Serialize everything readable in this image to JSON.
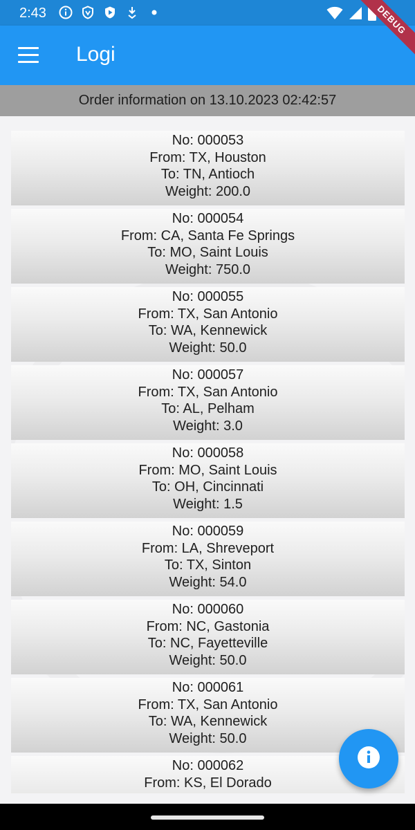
{
  "status_bar": {
    "time": "2:43",
    "icons": [
      "info-circle-icon",
      "shield-icon",
      "play-shield-icon",
      "download-icon",
      "dot-icon"
    ],
    "right_icons": [
      "wifi-icon",
      "signal-icon",
      "battery-icon"
    ]
  },
  "debug_banner": "DEBUG",
  "app_bar": {
    "title": "Logi",
    "menu_icon": "menu-icon",
    "color": "#2196f3"
  },
  "header": {
    "text": "Order information on 13.10.2023 02:42:57"
  },
  "orders": [
    {
      "no": "No: 000053",
      "from": "From: TX, Houston",
      "to": "To: TN, Antioch",
      "weight": "Weight: 200.0"
    },
    {
      "no": "No: 000054",
      "from": "From: CA, Santa Fe Springs",
      "to": "To: MO, Saint Louis",
      "weight": "Weight: 750.0"
    },
    {
      "no": "No: 000055",
      "from": "From: TX, San Antonio",
      "to": "To: WA, Kennewick",
      "weight": "Weight: 50.0"
    },
    {
      "no": "No: 000057",
      "from": "From: TX, San Antonio",
      "to": "To: AL, Pelham",
      "weight": "Weight: 3.0"
    },
    {
      "no": "No: 000058",
      "from": "From: MO, Saint Louis",
      "to": "To: OH, Cincinnati",
      "weight": "Weight: 1.5"
    },
    {
      "no": "No: 000059",
      "from": "From: LA, Shreveport",
      "to": "To: TX, Sinton",
      "weight": "Weight: 54.0"
    },
    {
      "no": "No: 000060",
      "from": "From: NC, Gastonia",
      "to": "To: NC, Fayetteville",
      "weight": "Weight: 50.0"
    },
    {
      "no": "No: 000061",
      "from": "From: TX, San Antonio",
      "to": "To: WA, Kennewick",
      "weight": "Weight: 50.0"
    },
    {
      "no": "No: 000062",
      "from": "From: KS, El Dorado",
      "to": "",
      "weight": ""
    }
  ],
  "fab": {
    "icon": "info-icon",
    "color": "#2196f3"
  }
}
